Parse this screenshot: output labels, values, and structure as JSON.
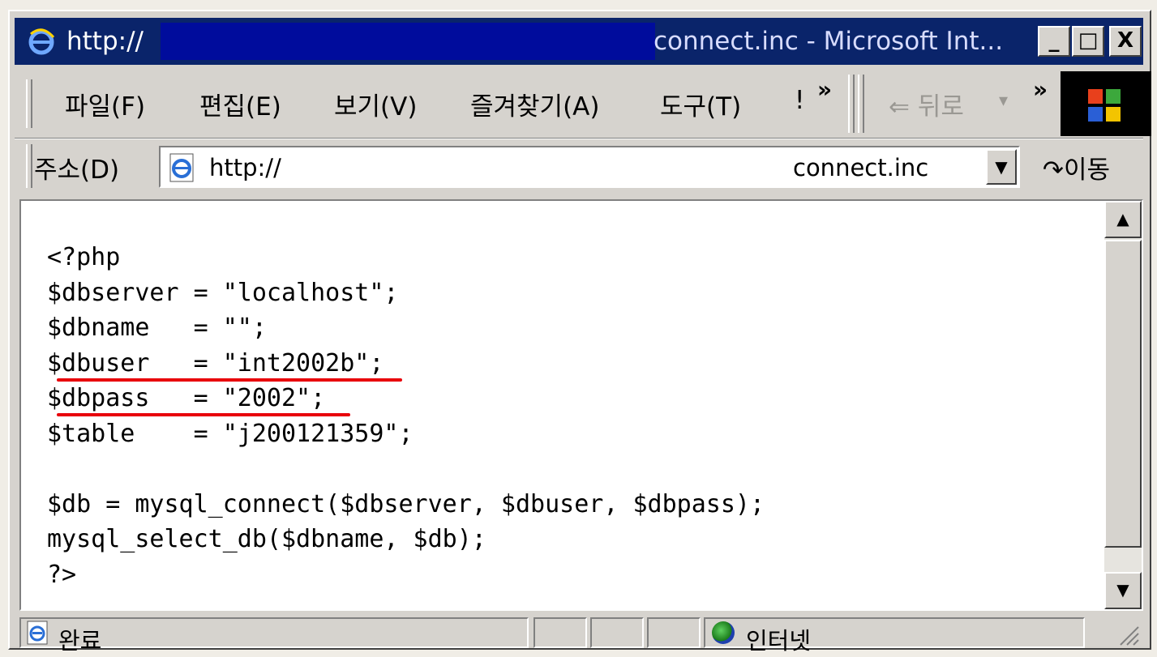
{
  "window": {
    "title_left": "http://",
    "title_right": "connect.inc - Microsoft Int...",
    "controls": {
      "minimize": "_",
      "maximize": "□",
      "close": "X"
    }
  },
  "menu": {
    "items": [
      "파일(F)",
      "편집(E)",
      "보기(V)",
      "즐겨찾기(A)",
      "도구(T)",
      "!"
    ],
    "more": "»",
    "back_label": "⇐ 뒤로",
    "back_more": "»"
  },
  "address": {
    "label": "주소(D)",
    "url_left": "http://",
    "url_right": "connect.inc",
    "go_label": "이동"
  },
  "code": {
    "lines": [
      "<?php",
      "$dbserver = \"localhost\";",
      "$dbname   = \"\";",
      "$dbuser   = \"int2002b\";",
      "$dbpass   = \"2002\";",
      "$table    = \"j200121359\";",
      "",
      "$db = mysql_connect($dbserver, $dbuser, $dbpass);",
      "mysql_select_db($dbname, $db);",
      "?>"
    ],
    "highlight_color": "#e8000a"
  },
  "status": {
    "text": "완료",
    "zone": "인터넷"
  },
  "colors": {
    "titlebar": "#0a246a",
    "chrome": "#d6d3ce"
  }
}
